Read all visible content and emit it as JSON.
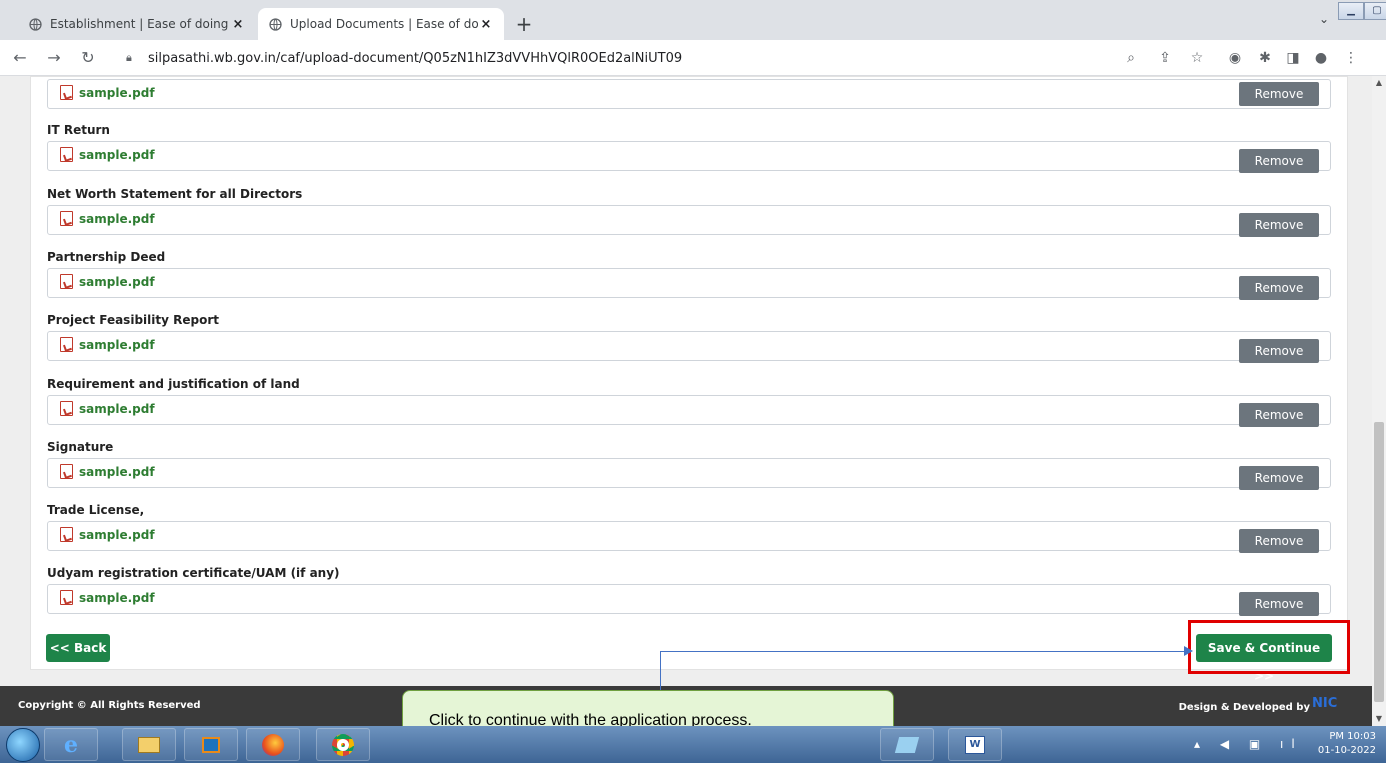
{
  "browser": {
    "tabs": [
      {
        "label": "Establishment | Ease of doing bus",
        "close": "×"
      },
      {
        "label": "Upload Documents | Ease of doir",
        "close": "×"
      }
    ],
    "new_tab": "+",
    "url": "silpasathi.wb.gov.in/caf/upload-document/Q05zN1hIZ3dVVHhVQlR0OEd2alNiUT09"
  },
  "documents": [
    {
      "label": "",
      "file": "sample.pdf",
      "remove_label": "Remove"
    },
    {
      "label": "IT Return",
      "file": "sample.pdf",
      "remove_label": "Remove"
    },
    {
      "label": "Net Worth Statement for all Directors",
      "file": "sample.pdf",
      "remove_label": "Remove"
    },
    {
      "label": "Partnership Deed",
      "file": "sample.pdf",
      "remove_label": "Remove"
    },
    {
      "label": "Project Feasibility Report",
      "file": "sample.pdf",
      "remove_label": "Remove"
    },
    {
      "label": "Requirement and justification of land",
      "file": "sample.pdf",
      "remove_label": "Remove"
    },
    {
      "label": "Signature",
      "file": "sample.pdf",
      "remove_label": "Remove"
    },
    {
      "label": "Trade License,",
      "file": "sample.pdf",
      "remove_label": "Remove"
    },
    {
      "label": "Udyam registration certificate/UAM (if any)",
      "file": "sample.pdf",
      "remove_label": "Remove"
    }
  ],
  "actions": {
    "back_label": "<< Back",
    "save_label": "Save & Continue >>"
  },
  "footer": {
    "copyright": "Copyright © All Rights Reserved",
    "developed_by": "Design & Developed by",
    "logo_text": "NIC"
  },
  "callout": {
    "text": "Click to continue with the application process."
  },
  "taskbar": {
    "time": "PM 10:03",
    "date": "01-10-2022"
  },
  "colors": {
    "primary_green": "#1e8449",
    "remove_gray": "#6c757d",
    "highlight_red": "#e00000",
    "callout_bg": "#e5f5d6"
  }
}
